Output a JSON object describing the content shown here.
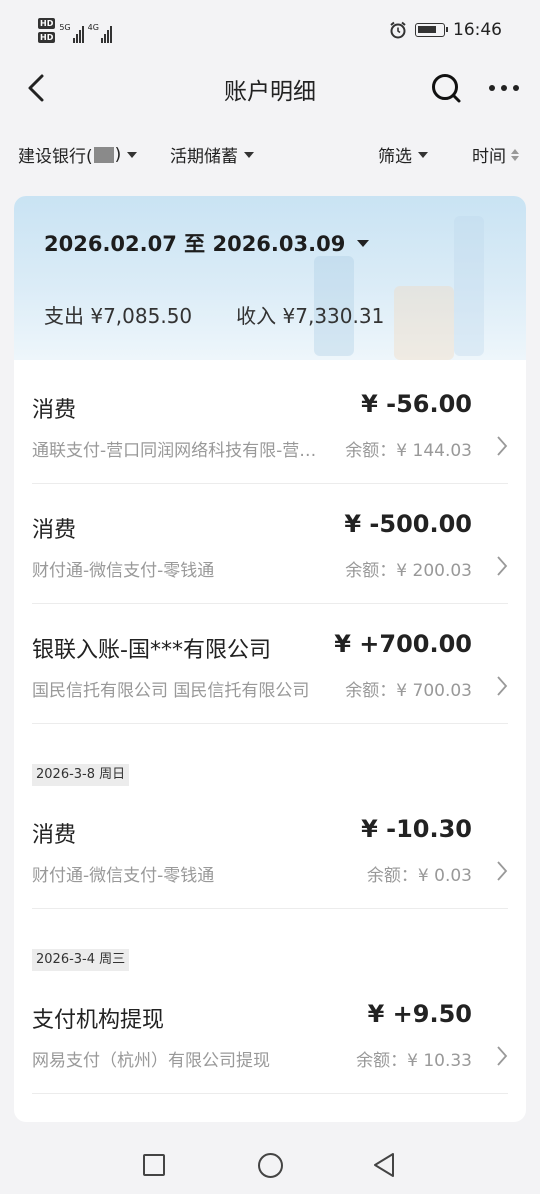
{
  "status": {
    "hd1": "HD",
    "hd2": "HD",
    "net1": "5G",
    "net2": "4G",
    "time": "16:46"
  },
  "header": {
    "title": "账户明细"
  },
  "filters": {
    "bank_prefix": "建设银行(",
    "bank_suffix": ")",
    "account_type": "活期储蓄",
    "filter": "筛选",
    "time": "时间"
  },
  "summary": {
    "date_range": "2026.02.07 至 2026.03.09",
    "expense": "支出 ¥7,085.50",
    "income": "收入 ¥7,330.31"
  },
  "transactions": [
    {
      "name": "消费",
      "amount": "¥ -56.00",
      "desc": "通联支付-营口同润网络科技有限-营口…",
      "balance": "余额：¥ 144.03"
    },
    {
      "name": "消费",
      "amount": "¥ -500.00",
      "desc": "财付通-微信支付-零钱通",
      "balance": "余额：¥ 200.03"
    },
    {
      "name": "银联入账-国***有限公司",
      "amount": "¥ +700.00",
      "desc": "国民信托有限公司 国民信托有限公司",
      "balance": "余额：¥ 700.03"
    }
  ],
  "groups": [
    {
      "date": "2026-3-8 周日",
      "items": [
        {
          "name": "消费",
          "amount": "¥ -10.30",
          "desc": "财付通-微信支付-零钱通",
          "balance": "余额：¥ 0.03"
        }
      ]
    },
    {
      "date": "2026-3-4 周三",
      "items": [
        {
          "name": "支付机构提现",
          "amount": "¥ +9.50",
          "desc": "网易支付（杭州）有限公司提现",
          "balance": "余额：¥ 10.33"
        }
      ]
    }
  ]
}
